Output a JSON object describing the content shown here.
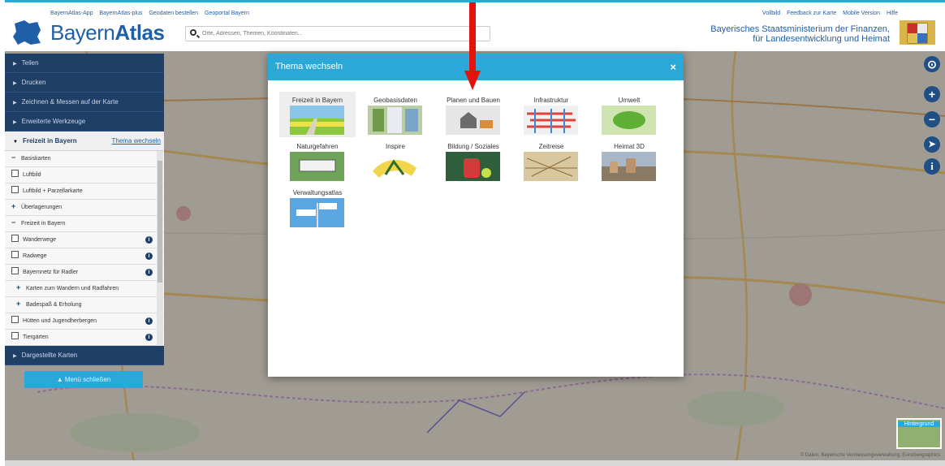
{
  "header": {
    "top_links": [
      "BayernAtlas-App",
      "BayernAtlas-plus",
      "Geodaten bestellen",
      "Geoportal Bayern"
    ],
    "right_links": [
      "Vollbild",
      "Feedback zur Karte",
      "Mobile Version",
      "Hilfe"
    ],
    "logo_light": "Bayern",
    "logo_bold": "Atlas",
    "search_placeholder": "Orte, Adressen, Themen, Koordinaten...",
    "ministry_line1": "Bayerisches Staatsministerium der Finanzen,",
    "ministry_line2": "für Landesentwicklung und Heimat"
  },
  "sidebar": {
    "items": [
      "Teilen",
      "Drucken",
      "Zeichnen & Messen auf der Karte",
      "Erweiterte Werkzeuge"
    ],
    "theme_label": "Freizeit in Bayern",
    "theme_change": "Thema wechseln",
    "layers": [
      {
        "label": "Basiskarten",
        "kind": "minus"
      },
      {
        "label": "Luftbild",
        "kind": "checkbox"
      },
      {
        "label": "Luftbild + Parzellarkarte",
        "kind": "checkbox"
      },
      {
        "label": "Überlagerungen",
        "kind": "plus"
      },
      {
        "label": "Freizeit in Bayern",
        "kind": "minus"
      },
      {
        "label": "Wanderwege",
        "kind": "checkbox",
        "info": true
      },
      {
        "label": "Radwege",
        "kind": "checkbox",
        "info": true
      },
      {
        "label": "Bayernnetz für Radler",
        "kind": "checkbox",
        "info": true
      },
      {
        "label": "Karten zum Wandern und Radfahren",
        "kind": "plus-sub"
      },
      {
        "label": "Badespaß & Erholung",
        "kind": "plus-sub"
      },
      {
        "label": "Hütten und Jugendherbergen",
        "kind": "checkbox",
        "info": true
      },
      {
        "label": "Tiergärten",
        "kind": "checkbox",
        "info": true
      }
    ],
    "bottom_item": "Dargestellte Karten",
    "close_button": "Menü schließen"
  },
  "modal": {
    "title": "Thema wechseln",
    "close": "×",
    "themes": [
      "Freizeit in Bayern",
      "Geobasisdaten",
      "Planen und Bauen",
      "Infrastruktur",
      "Umwelt",
      "Naturgefahren",
      "Inspire",
      "Bildung / Soziales",
      "Zeitreise",
      "Heimat 3D",
      "Verwaltungsatlas"
    ]
  },
  "controls": {
    "location": "⊙",
    "zoom_in": "+",
    "zoom_out": "−",
    "info": "i"
  },
  "hintergrund": "Hintergrund",
  "copyright": "© Daten: Bayerische Vermessungsverwaltung, EuroGeographics",
  "colors": {
    "brand_blue": "#1f5fa8",
    "accent_cyan": "#2aa9d9",
    "sidebar_navy": "#1f3f66",
    "arrow_red": "#e3120b"
  }
}
